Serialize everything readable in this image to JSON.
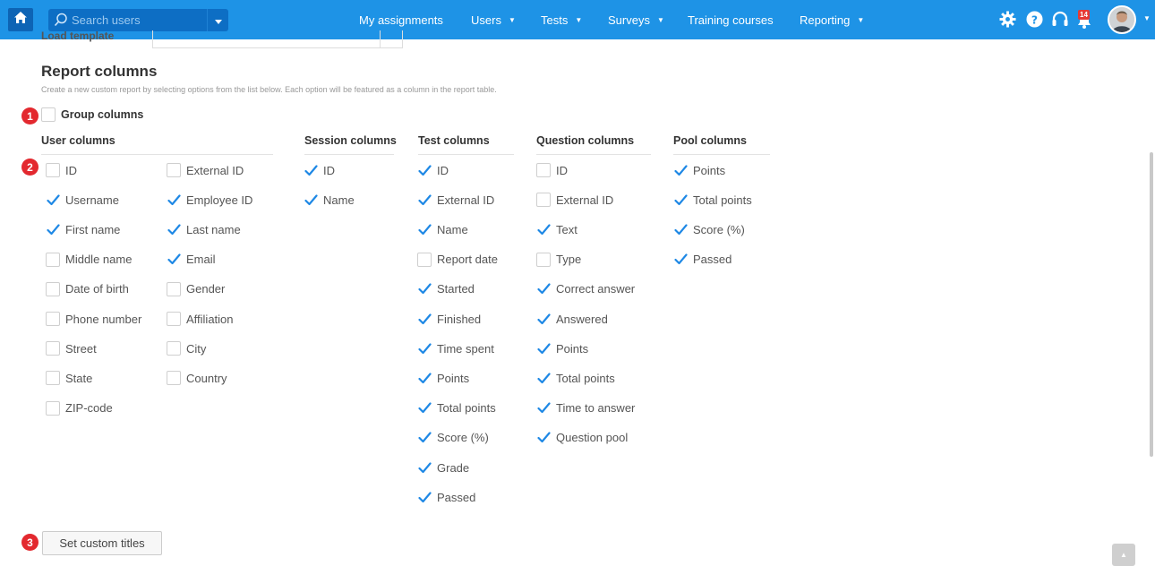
{
  "nav": {
    "search_placeholder": "Search users",
    "items": [
      {
        "label": "My assignments",
        "caret": false
      },
      {
        "label": "Users",
        "caret": true
      },
      {
        "label": "Tests",
        "caret": true
      },
      {
        "label": "Surveys",
        "caret": true
      },
      {
        "label": "Training courses",
        "caret": false
      },
      {
        "label": "Reporting",
        "caret": true
      }
    ],
    "notification_count": "14",
    "icons": [
      "home-icon",
      "search-icon",
      "gear-icon",
      "help-icon",
      "headset-icon",
      "bell-icon"
    ]
  },
  "partial_row": {
    "label": "Load template"
  },
  "page": {
    "title": "Report columns",
    "subtitle": "Create a new custom report by selecting options from the list below. Each option will be featured as a column in the report table.",
    "group_columns": {
      "label": "Group columns",
      "checked": false
    },
    "markers": [
      "1",
      "2",
      "3"
    ],
    "set_custom_titles": "Set custom titles"
  },
  "columns": [
    {
      "heading": "User columns",
      "items": [
        [
          {
            "label": "ID",
            "checked": false
          },
          {
            "label": "External ID",
            "checked": false
          }
        ],
        [
          {
            "label": "Username",
            "checked": true
          },
          {
            "label": "Employee ID",
            "checked": true
          }
        ],
        [
          {
            "label": "First name",
            "checked": true
          },
          {
            "label": "Last name",
            "checked": true
          }
        ],
        [
          {
            "label": "Middle name",
            "checked": false
          },
          {
            "label": "Email",
            "checked": true
          }
        ],
        [
          {
            "label": "Date of birth",
            "checked": false
          },
          {
            "label": "Gender",
            "checked": false
          }
        ],
        [
          {
            "label": "Phone number",
            "checked": false
          },
          {
            "label": "Affiliation",
            "checked": false
          }
        ],
        [
          {
            "label": "Street",
            "checked": false
          },
          {
            "label": "City",
            "checked": false
          }
        ],
        [
          {
            "label": "State",
            "checked": false
          },
          {
            "label": "Country",
            "checked": false
          }
        ],
        [
          {
            "label": "ZIP-code",
            "checked": false
          }
        ]
      ]
    },
    {
      "heading": "Session columns",
      "items": [
        {
          "label": "ID",
          "checked": true
        },
        {
          "label": "Name",
          "checked": true
        }
      ]
    },
    {
      "heading": "Test columns",
      "items": [
        {
          "label": "ID",
          "checked": true
        },
        {
          "label": "External ID",
          "checked": true
        },
        {
          "label": "Name",
          "checked": true
        },
        {
          "label": "Report date",
          "checked": false
        },
        {
          "label": "Started",
          "checked": true
        },
        {
          "label": "Finished",
          "checked": true
        },
        {
          "label": "Time spent",
          "checked": true
        },
        {
          "label": "Points",
          "checked": true
        },
        {
          "label": "Total points",
          "checked": true
        },
        {
          "label": "Score (%)",
          "checked": true
        },
        {
          "label": "Grade",
          "checked": true
        },
        {
          "label": "Passed",
          "checked": true
        }
      ]
    },
    {
      "heading": "Question columns",
      "items": [
        {
          "label": "ID",
          "checked": false
        },
        {
          "label": "External ID",
          "checked": false
        },
        {
          "label": "Text",
          "checked": true
        },
        {
          "label": "Type",
          "checked": false
        },
        {
          "label": "Correct answer",
          "checked": true
        },
        {
          "label": "Answered",
          "checked": true
        },
        {
          "label": "Points",
          "checked": true
        },
        {
          "label": "Total points",
          "checked": true
        },
        {
          "label": "Time to answer",
          "checked": true
        },
        {
          "label": "Question pool",
          "checked": true
        }
      ]
    },
    {
      "heading": "Pool columns",
      "items": [
        {
          "label": "Points",
          "checked": true
        },
        {
          "label": "Total points",
          "checked": true
        },
        {
          "label": "Score (%)",
          "checked": true
        },
        {
          "label": "Passed",
          "checked": true
        }
      ]
    }
  ],
  "colors": {
    "brand": "#1e93e6",
    "check": "#1e88e5",
    "marker": "#e3292f"
  }
}
